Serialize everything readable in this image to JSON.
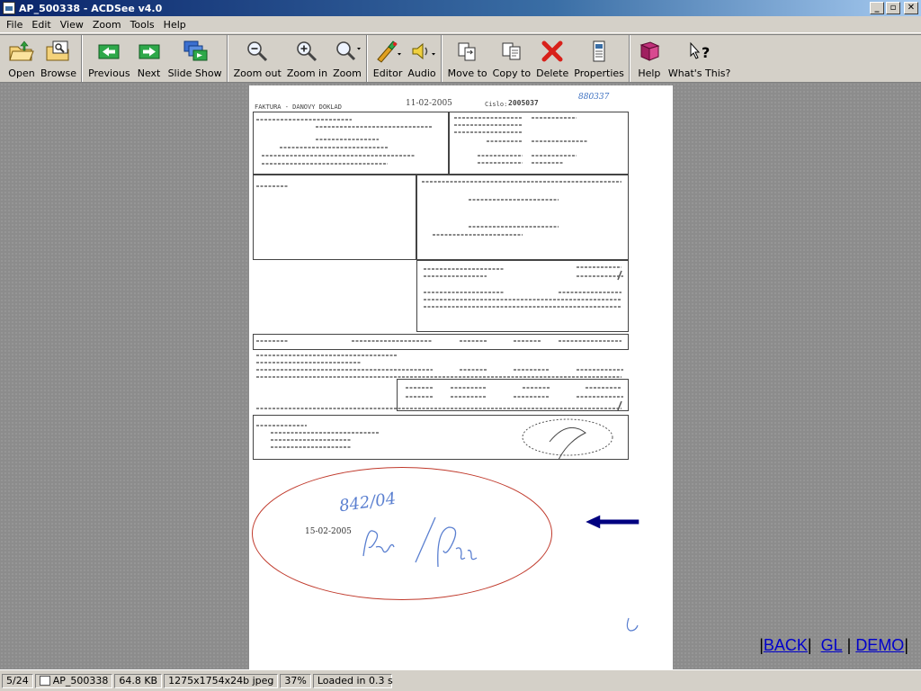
{
  "window": {
    "title": "AP_500338 - ACDSee v4.0",
    "controls": [
      "_",
      "▫",
      "✕"
    ]
  },
  "menu": [
    "File",
    "Edit",
    "View",
    "Zoom",
    "Tools",
    "Help"
  ],
  "toolbar": {
    "open": "Open",
    "browse": "Browse",
    "previous": "Previous",
    "next": "Next",
    "slideshow": "Slide Show",
    "zoom_out": "Zoom out",
    "zoom_in": "Zoom in",
    "zoom": "Zoom",
    "editor": "Editor",
    "audio": "Audio",
    "move_to": "Move to",
    "copy_to": "Copy to",
    "delete": "Delete",
    "properties": "Properties",
    "help": "Help",
    "whats_this": "What's This?"
  },
  "document": {
    "heading": "FAKTURA - DANOVY DOKLAD",
    "date": "11-02-2005",
    "number_label": "Cislo:",
    "number": "2005037",
    "handwritten_ref": "880337",
    "stamp_date": "15-02-2005",
    "handwritten_code": "842/04"
  },
  "nav": {
    "back": "BACK",
    "gl": "GL",
    "demo": "DEMO"
  },
  "status": {
    "index": "5/24",
    "filename": "AP_500338",
    "size": "64.8 KB",
    "dimensions": "1275x1754x24b jpeg",
    "zoom": "37%",
    "load": "Loaded in 0.3 s"
  },
  "colors": {
    "title_bar": "#0a246a",
    "stamp_oval": "#c0392b",
    "arrow": "#000080",
    "link": "#0000cc"
  }
}
